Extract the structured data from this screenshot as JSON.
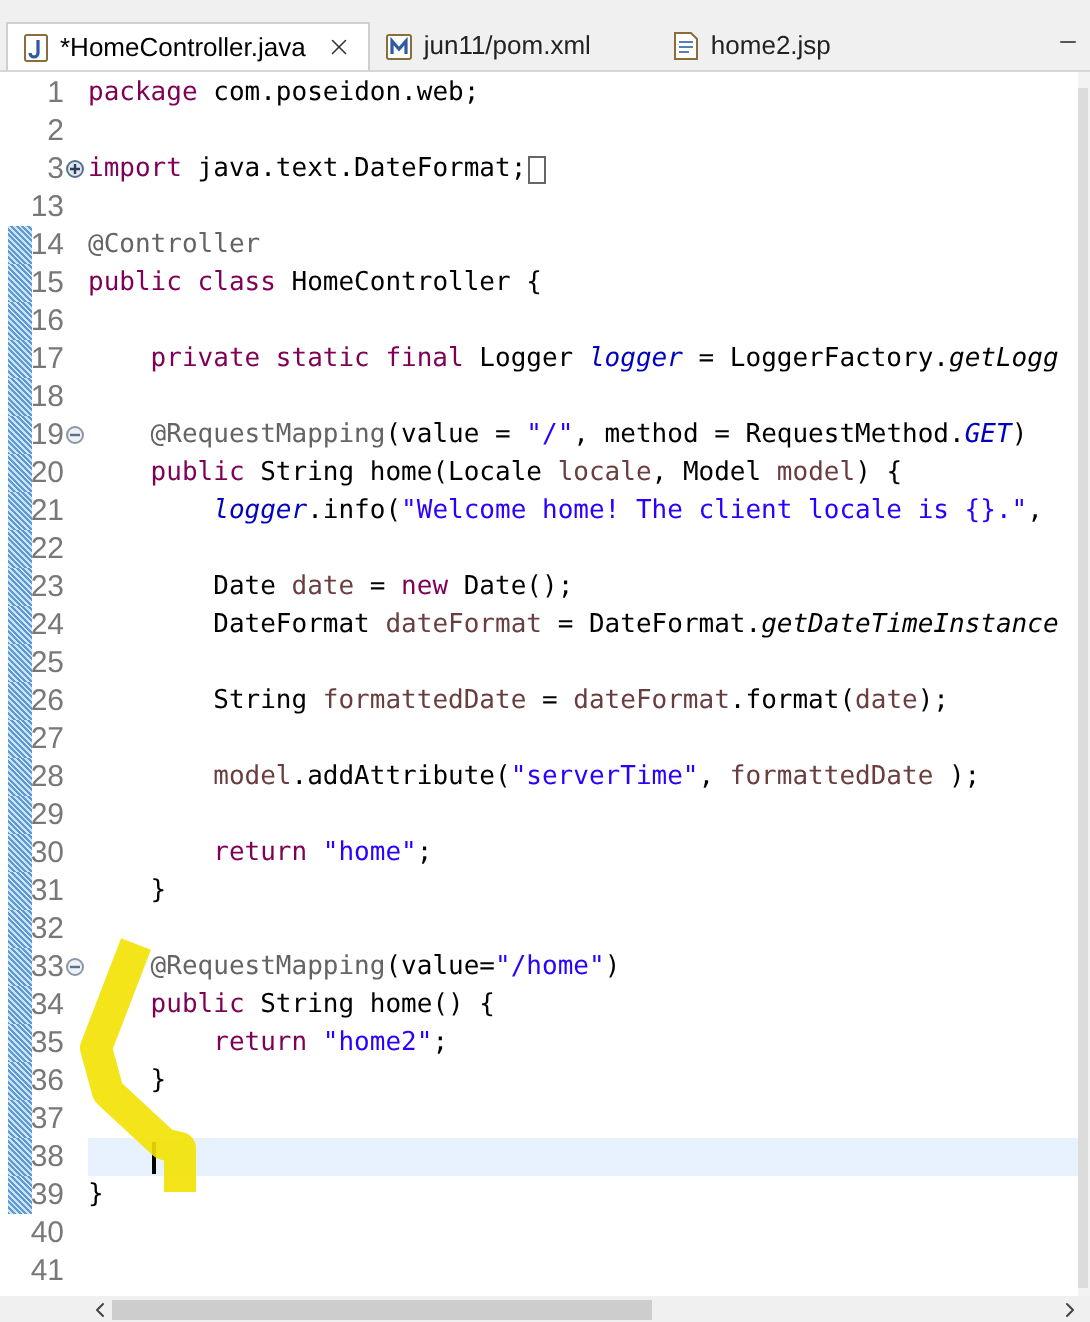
{
  "tabs": [
    {
      "label": "*HomeController.java",
      "selected": true,
      "kind": "java"
    },
    {
      "label": "jun11/pom.xml",
      "selected": false,
      "kind": "maven"
    },
    {
      "label": "home2.jsp",
      "selected": false,
      "kind": "file"
    }
  ],
  "editor": {
    "lines": [
      {
        "number": "1",
        "changed": false,
        "current": false,
        "tokens": [
          {
            "kind": "kw",
            "text": "package"
          },
          {
            "kind": "plain",
            "text": " com.poseidon.web;"
          }
        ]
      },
      {
        "number": "2",
        "changed": false,
        "current": false
      },
      {
        "number": "3",
        "changed": false,
        "current": false,
        "folded": true,
        "tokens": [
          {
            "kind": "kw",
            "text": "import"
          },
          {
            "kind": "plain",
            "text": " java.text.DateFormat;"
          }
        ]
      },
      {
        "number": "13",
        "changed": false,
        "current": false
      },
      {
        "number": "14",
        "changed": true,
        "current": false,
        "tokens": [
          {
            "kind": "ann",
            "text": "@Controller"
          }
        ]
      },
      {
        "number": "15",
        "changed": true,
        "current": false,
        "tokens": [
          {
            "kind": "kw",
            "text": "public class"
          },
          {
            "kind": "plain",
            "text": " HomeController {"
          }
        ]
      },
      {
        "number": "16",
        "changed": true,
        "current": false
      },
      {
        "number": "17",
        "changed": true,
        "current": false,
        "tokens": [
          {
            "kind": "kw",
            "text": "    private static final"
          },
          {
            "kind": "plain",
            "text": " Logger "
          },
          {
            "kind": "field",
            "text": "logger"
          },
          {
            "kind": "plain",
            "text": " = LoggerFactory."
          },
          {
            "kind": "static",
            "text": "getLogg"
          }
        ]
      },
      {
        "number": "18",
        "changed": true,
        "current": false
      },
      {
        "number": "19",
        "changed": true,
        "current": false,
        "folded": false,
        "tokens": [
          {
            "kind": "ann",
            "text": "    @RequestMapping"
          },
          {
            "kind": "plain",
            "text": "(value = "
          },
          {
            "kind": "str",
            "text": "\"/\""
          },
          {
            "kind": "plain",
            "text": ", method = RequestMethod."
          },
          {
            "kind": "field",
            "text": "GET"
          },
          {
            "kind": "plain",
            "text": ")"
          }
        ]
      },
      {
        "number": "20",
        "changed": true,
        "current": false,
        "tokens": [
          {
            "kind": "kw",
            "text": "    public"
          },
          {
            "kind": "plain",
            "text": " String home(Locale "
          },
          {
            "kind": "local",
            "text": "locale"
          },
          {
            "kind": "plain",
            "text": ", Model "
          },
          {
            "kind": "local",
            "text": "model"
          },
          {
            "kind": "plain",
            "text": ") {"
          }
        ]
      },
      {
        "number": "21",
        "changed": true,
        "current": false,
        "tokens": [
          {
            "kind": "field",
            "text": "        logger"
          },
          {
            "kind": "plain",
            "text": ".info("
          },
          {
            "kind": "str",
            "text": "\"Welcome home! The client locale is {}.\""
          },
          {
            "kind": "plain",
            "text": ","
          }
        ]
      },
      {
        "number": "22",
        "changed": true,
        "current": false
      },
      {
        "number": "23",
        "changed": true,
        "current": false,
        "tokens": [
          {
            "kind": "plain",
            "text": "        Date "
          },
          {
            "kind": "local",
            "text": "date"
          },
          {
            "kind": "plain",
            "text": " = "
          },
          {
            "kind": "kw",
            "text": "new"
          },
          {
            "kind": "plain",
            "text": " Date();"
          }
        ]
      },
      {
        "number": "24",
        "changed": true,
        "current": false,
        "tokens": [
          {
            "kind": "plain",
            "text": "        DateFormat "
          },
          {
            "kind": "local",
            "text": "dateFormat"
          },
          {
            "kind": "plain",
            "text": " = DateFormat."
          },
          {
            "kind": "static",
            "text": "getDateTimeInstance"
          }
        ]
      },
      {
        "number": "25",
        "changed": true,
        "current": false
      },
      {
        "number": "26",
        "changed": true,
        "current": false,
        "tokens": [
          {
            "kind": "plain",
            "text": "        String "
          },
          {
            "kind": "local",
            "text": "formattedDate"
          },
          {
            "kind": "plain",
            "text": " = "
          },
          {
            "kind": "local",
            "text": "dateFormat"
          },
          {
            "kind": "plain",
            "text": ".format("
          },
          {
            "kind": "local",
            "text": "date"
          },
          {
            "kind": "plain",
            "text": ");"
          }
        ]
      },
      {
        "number": "27",
        "changed": true,
        "current": false
      },
      {
        "number": "28",
        "changed": true,
        "current": false,
        "tokens": [
          {
            "kind": "local",
            "text": "        model"
          },
          {
            "kind": "plain",
            "text": ".addAttribute("
          },
          {
            "kind": "str",
            "text": "\"serverTime\""
          },
          {
            "kind": "plain",
            "text": ", "
          },
          {
            "kind": "local",
            "text": "formattedDate"
          },
          {
            "kind": "plain",
            "text": " );"
          }
        ]
      },
      {
        "number": "29",
        "changed": true,
        "current": false
      },
      {
        "number": "30",
        "changed": true,
        "current": false,
        "tokens": [
          {
            "kind": "kw",
            "text": "        return "
          },
          {
            "kind": "str",
            "text": "\"home\""
          },
          {
            "kind": "plain",
            "text": ";"
          }
        ]
      },
      {
        "number": "31",
        "changed": true,
        "current": false,
        "tokens": [
          {
            "kind": "plain",
            "text": "    }"
          }
        ]
      },
      {
        "number": "32",
        "changed": true,
        "current": false
      },
      {
        "number": "33",
        "changed": true,
        "current": false,
        "folded": false,
        "tokens": [
          {
            "kind": "ann",
            "text": "    @RequestMapping"
          },
          {
            "kind": "plain",
            "text": "(value="
          },
          {
            "kind": "str",
            "text": "\"/home\""
          },
          {
            "kind": "plain",
            "text": ")"
          }
        ]
      },
      {
        "number": "34",
        "changed": true,
        "current": false,
        "tokens": [
          {
            "kind": "kw",
            "text": "    public"
          },
          {
            "kind": "plain",
            "text": " String home() {"
          }
        ]
      },
      {
        "number": "35",
        "changed": true,
        "current": false,
        "tokens": [
          {
            "kind": "kw",
            "text": "        return "
          },
          {
            "kind": "str",
            "text": "\"home2\""
          },
          {
            "kind": "plain",
            "text": ";"
          }
        ]
      },
      {
        "number": "36",
        "changed": true,
        "current": false,
        "tokens": [
          {
            "kind": "plain",
            "text": "    }"
          }
        ]
      },
      {
        "number": "37",
        "changed": true,
        "current": false
      },
      {
        "number": "38",
        "changed": true,
        "current": true
      },
      {
        "number": "39",
        "changed": true,
        "current": false,
        "tokens": [
          {
            "kind": "plain",
            "text": "}"
          }
        ]
      },
      {
        "number": "40",
        "changed": false,
        "current": false
      },
      {
        "number": "41",
        "changed": false,
        "current": false
      }
    ]
  }
}
